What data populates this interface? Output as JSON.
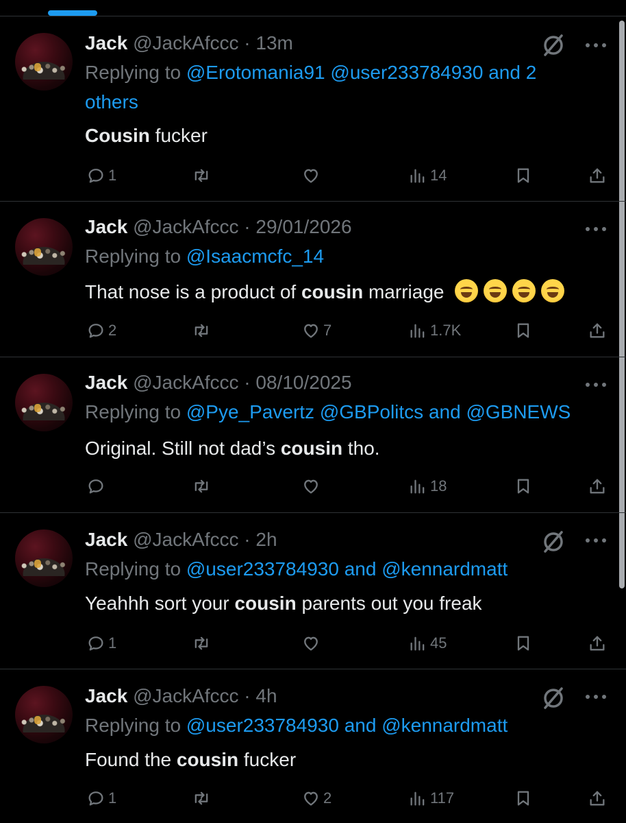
{
  "tweets": [
    {
      "name": "Jack",
      "meta": "@JackAfccc · 13m",
      "reply_prefix": "Replying to ",
      "reply_to": "@Erotomania91 @user233784930 and 2 others",
      "bold_first": "Cousin",
      "text_after": " fucker",
      "grok": true,
      "replies": "1",
      "retweets": "",
      "likes": "",
      "views": "14"
    },
    {
      "name": "Jack",
      "meta": "@JackAfccc · 29/01/2026",
      "reply_prefix": "Replying to ",
      "reply_to": "@Isaacmcfc_14",
      "text_before": "That nose is a product of ",
      "bold": "cousin",
      "text_after": " marriage",
      "emoji_count": 4,
      "grok": false,
      "replies": "2",
      "retweets": "",
      "likes": "7",
      "views": "1.7K"
    },
    {
      "name": "Jack",
      "meta": "@JackAfccc · 08/10/2025",
      "reply_prefix": "Replying to ",
      "reply_to": "@Pye_Pavertz @GBPolitcs and @GBNEWS",
      "text_before": "Original. Still not dad’s ",
      "bold": "cousin",
      "text_after": " tho.",
      "grok": false,
      "replies": "",
      "retweets": "",
      "likes": "",
      "views": "18"
    },
    {
      "name": "Jack",
      "meta": "@JackAfccc · 2h",
      "reply_prefix": "Replying to ",
      "reply_to": "@user233784930 and @kennardmatt",
      "text_before": "Yeahhh sort your ",
      "bold": "cousin",
      "text_after": " parents out you freak",
      "grok": true,
      "replies": "1",
      "retweets": "",
      "likes": "",
      "views": "45"
    },
    {
      "name": "Jack",
      "meta": "@JackAfccc · 4h",
      "reply_prefix": "Replying to ",
      "reply_to": "@user233784930 and @kennardmatt",
      "text_before": "Found the ",
      "bold": "cousin",
      "text_after": " fucker",
      "grok": true,
      "replies": "1",
      "retweets": "",
      "likes": "2",
      "views": "117"
    }
  ],
  "icons": {
    "reply": "reply-bubble-icon",
    "retweet": "retweet-icon",
    "like": "heart-icon",
    "views": "views-chart-icon",
    "bookmark": "bookmark-icon",
    "share": "share-icon",
    "grok": "grok-icon",
    "more": "more-dots-icon"
  },
  "colors": {
    "background": "#000000",
    "text": "#e7e9ea",
    "muted": "#71767b",
    "link": "#1d9bf0",
    "divider": "#2f3336"
  }
}
